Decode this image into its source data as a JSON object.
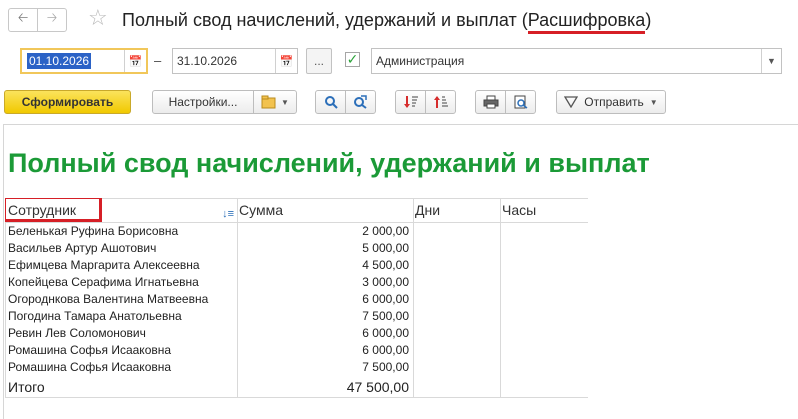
{
  "window": {
    "title_main": "Полный свод начислений, удержаний и выплат",
    "title_decode": "Расшифровка"
  },
  "params": {
    "date_from": "01.10.2026",
    "dash": "–",
    "date_to": "31.10.2026",
    "dots_label": "...",
    "org_checked": true,
    "organization": "Администрация"
  },
  "toolbar": {
    "generate_label": "Сформировать",
    "settings_label": "Настройки...",
    "send_label": "Отправить"
  },
  "report": {
    "title": "Полный свод начислений, удержаний и выплат",
    "columns": [
      "Сотрудник",
      "Сумма",
      "Дни",
      "Часы"
    ],
    "rows": [
      {
        "name": "Беленькая Руфина Борисовна",
        "sum": "2 000,00",
        "days": "",
        "hours": ""
      },
      {
        "name": "Васильев Артур Ашотович",
        "sum": "5 000,00",
        "days": "",
        "hours": ""
      },
      {
        "name": "Ефимцева Маргарита Алексеевна",
        "sum": "4 500,00",
        "days": "",
        "hours": ""
      },
      {
        "name": "Копейцева Серафима Игнатьевна",
        "sum": "3 000,00",
        "days": "",
        "hours": ""
      },
      {
        "name": "Огороднкова Валентина Матвеевна",
        "sum": "6 000,00",
        "days": "",
        "hours": ""
      },
      {
        "name": "Погодина Тамара Анатольевна",
        "sum": "7 500,00",
        "days": "",
        "hours": ""
      },
      {
        "name": "Ревин Лев Соломонович",
        "sum": "6 000,00",
        "days": "",
        "hours": ""
      },
      {
        "name": "Ромашина Софья Исааковна",
        "sum": "6 000,00",
        "days": "",
        "hours": ""
      },
      {
        "name": "Ромашина Софья Исааковна",
        "sum": "7 500,00",
        "days": "",
        "hours": ""
      }
    ],
    "total": {
      "label": "Итого",
      "sum": "47 500,00"
    }
  },
  "colors": {
    "report_title": "#1b9a37",
    "highlight": "#d61f26",
    "primary_button": "#f1c900",
    "date_selection": "#2b62c6"
  }
}
